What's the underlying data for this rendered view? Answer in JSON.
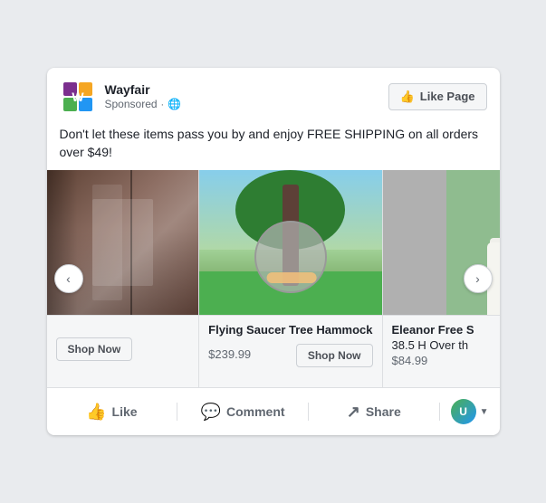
{
  "card": {
    "brand": {
      "name": "Wayfair",
      "sponsored": "Sponsored",
      "globe": "🌐"
    },
    "like_page_btn": "Like Page",
    "ad_text": "Don't let these items pass you by and enjoy FREE SHIPPING on all orders over $49!",
    "carousel": {
      "items": [
        {
          "id": "closet",
          "title": "",
          "price": "",
          "shop_now": "Shop Now",
          "image_type": "closet"
        },
        {
          "id": "hammock",
          "title": "Flying Saucer Tree Hammock",
          "price": "$239.99",
          "shop_now": "Shop Now",
          "image_type": "hammock"
        },
        {
          "id": "bathroom",
          "title": "Eleanor Free S",
          "subtitle": "38.5 H Over th",
          "price": "$84.99",
          "shop_now": "",
          "image_type": "bathroom"
        }
      ],
      "prev_label": "‹",
      "next_label": "›"
    },
    "footer": {
      "actions": [
        {
          "id": "like",
          "label": "Like",
          "icon": "👍"
        },
        {
          "id": "comment",
          "label": "Comment",
          "icon": "💬"
        },
        {
          "id": "share",
          "label": "Share",
          "icon": "↗"
        }
      ],
      "avatar_initial": "U"
    }
  }
}
